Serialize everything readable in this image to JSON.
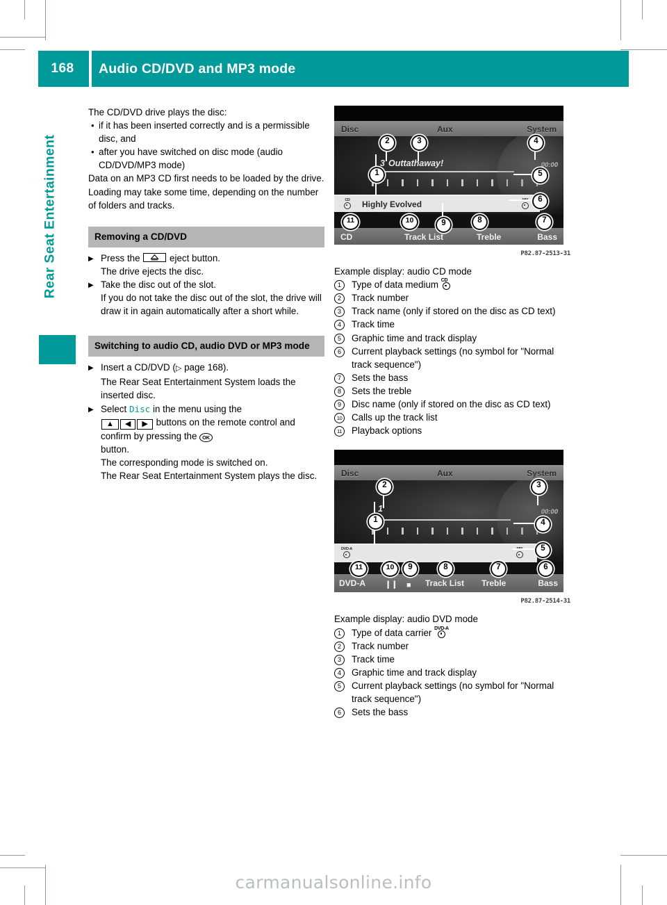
{
  "header": {
    "page_number": "168",
    "title": "Audio CD/DVD and MP3 mode"
  },
  "sidebar": {
    "chapter_label": "Rear Seat Entertainment"
  },
  "left_column": {
    "intro": "The CD/DVD drive plays the disc:",
    "bullets": [
      "if it has been inserted correctly and is a permissible disc, and",
      "after you have switched on disc mode (audio CD/DVD/MP3 mode)"
    ],
    "paragraph": "Data on an MP3 CD first needs to be loaded by the drive. Loading may take some time, depending on the number of folders and tracks.",
    "section1": {
      "heading": "Removing a CD/DVD",
      "steps": [
        {
          "lead_before": "Press the",
          "symbol": "eject-button",
          "lead_after": "eject button.",
          "detail": "The drive ejects the disc."
        },
        {
          "lead_before": "Take the disc out of the slot.",
          "detail": "If you do not take the disc out of the slot, the drive will draw it in again automatically after a short while."
        }
      ]
    },
    "section2": {
      "heading": "Switching to audio CD, audio DVD or MP3 mode",
      "step1": {
        "text_before": "Insert a CD/DVD (",
        "ref_symbol": "▷",
        "ref_text": " page 168).",
        "text_after": "",
        "detail": "The Rear Seat Entertainment System loads the inserted disc."
      },
      "step2": {
        "text_a": "Select ",
        "menu_item": "Disc",
        "text_b": " in the menu using the",
        "buttons": [
          "▲",
          "◀",
          "▶"
        ],
        "text_c": "buttons on the remote control and confirm by pressing the",
        "ok_label": "OK",
        "text_d": "button.",
        "detail1": "The corresponding mode is switched on.",
        "detail2": "The Rear Seat Entertainment System plays the disc."
      }
    }
  },
  "figure_cd": {
    "image_code": "P82.87-2513-31",
    "caption": "Example display: audio CD mode",
    "menubar": {
      "left": "Disc",
      "center": "Aux",
      "right": "System"
    },
    "track_number": "3",
    "track_name": "Outtathaway!",
    "track_time": "00:00",
    "disc_name": "Highly Evolved",
    "media_label_top": "CD",
    "softkeys": [
      "CD",
      "Track List",
      "Treble",
      "Bass"
    ],
    "callouts": [
      "1",
      "2",
      "3",
      "4",
      "5",
      "6",
      "7",
      "8",
      "9",
      "10",
      "11"
    ],
    "legend": [
      {
        "n": "1",
        "text": "Type of data medium",
        "symbol": "CD"
      },
      {
        "n": "2",
        "text": "Track number"
      },
      {
        "n": "3",
        "text": "Track name (only if stored on the disc as CD text)"
      },
      {
        "n": "4",
        "text": "Track time"
      },
      {
        "n": "5",
        "text": "Graphic time and track display"
      },
      {
        "n": "6",
        "text": "Current playback settings (no symbol for \"Normal track sequence\")"
      },
      {
        "n": "7",
        "text": "Sets the bass"
      },
      {
        "n": "8",
        "text": "Sets the treble"
      },
      {
        "n": "9",
        "text": "Disc name (only if stored on the disc as CD text)"
      },
      {
        "n": "10",
        "text": "Calls up the track list"
      },
      {
        "n": "11",
        "text": "Playback options"
      }
    ]
  },
  "figure_dvd": {
    "image_code": "P82.87-2514-31",
    "caption": "Example display: audio DVD mode",
    "menubar": {
      "left": "Disc",
      "center": "Aux",
      "right": "System"
    },
    "track_number": "1",
    "track_time": "00:00",
    "media_label_top": "DVD-A",
    "softkeys": [
      "DVD-A",
      "Track List",
      "Treble",
      "Bass"
    ],
    "transport_icons": [
      "pause-icon",
      "stop-icon"
    ],
    "callouts": [
      "1",
      "2",
      "3",
      "4",
      "5",
      "6",
      "7",
      "8",
      "9",
      "10",
      "11"
    ],
    "legend": [
      {
        "n": "1",
        "text": "Type of data carrier",
        "symbol": "DVD-A"
      },
      {
        "n": "2",
        "text": "Track number"
      },
      {
        "n": "3",
        "text": "Track time"
      },
      {
        "n": "4",
        "text": "Graphic time and track display"
      },
      {
        "n": "5",
        "text": "Current playback settings (no symbol for \"Normal track sequence\")"
      },
      {
        "n": "6",
        "text": "Sets the bass"
      }
    ]
  },
  "watermark": "carmanualsonline.info",
  "colors": {
    "accent_teal": "#009a9a",
    "section_band": "#b5b5b5"
  }
}
